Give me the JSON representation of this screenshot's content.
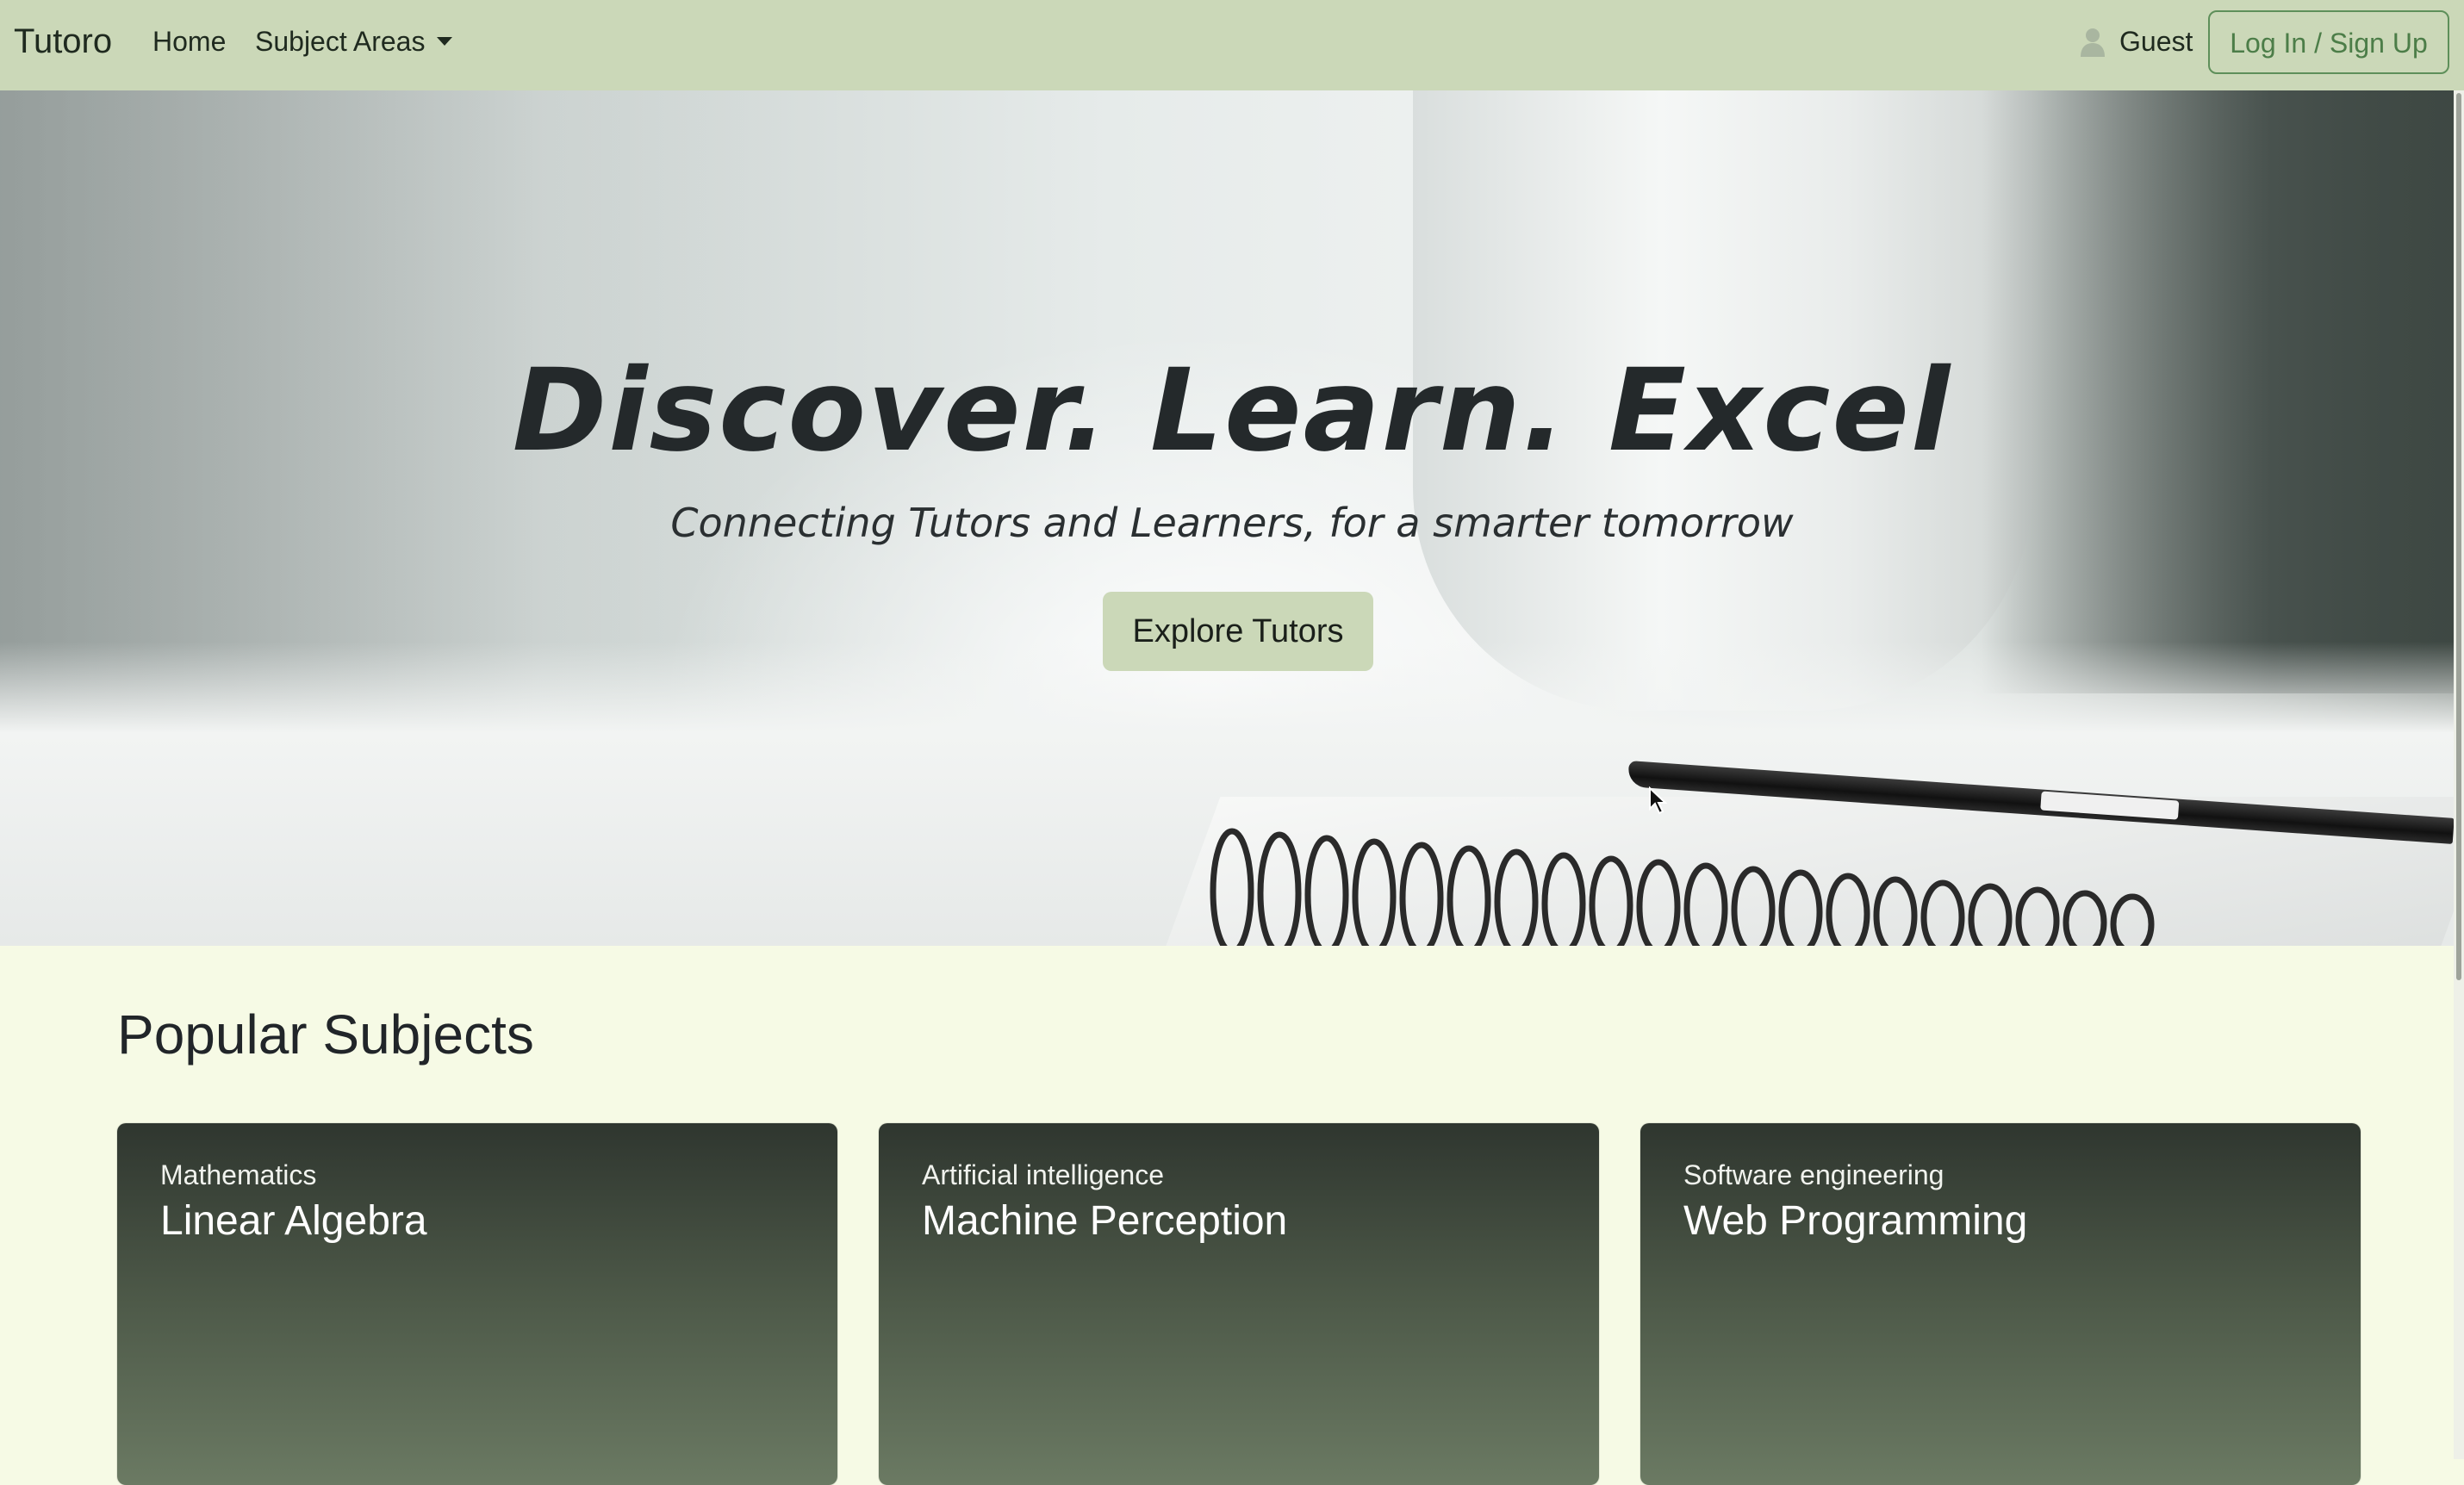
{
  "navbar": {
    "brand": "Tutoro",
    "links": [
      {
        "label": "Home"
      },
      {
        "label": "Subject Areas",
        "dropdown": true
      }
    ],
    "user": {
      "icon": "user-icon",
      "name": "Guest"
    },
    "login_label": "Log In / Sign Up",
    "accent_color": "#cbd8b8"
  },
  "hero": {
    "title": "Discover. Learn. Excel",
    "subtitle": "Connecting Tutors and Learners, for a smarter tomorrow",
    "cta_label": "Explore Tutors"
  },
  "popular": {
    "title": "Popular Subjects",
    "cards": [
      {
        "category": "Mathematics",
        "title": "Linear Algebra"
      },
      {
        "category": "Artificial intelligence",
        "title": "Machine Perception"
      },
      {
        "category": "Software engineering",
        "title": "Web Programming"
      }
    ]
  }
}
